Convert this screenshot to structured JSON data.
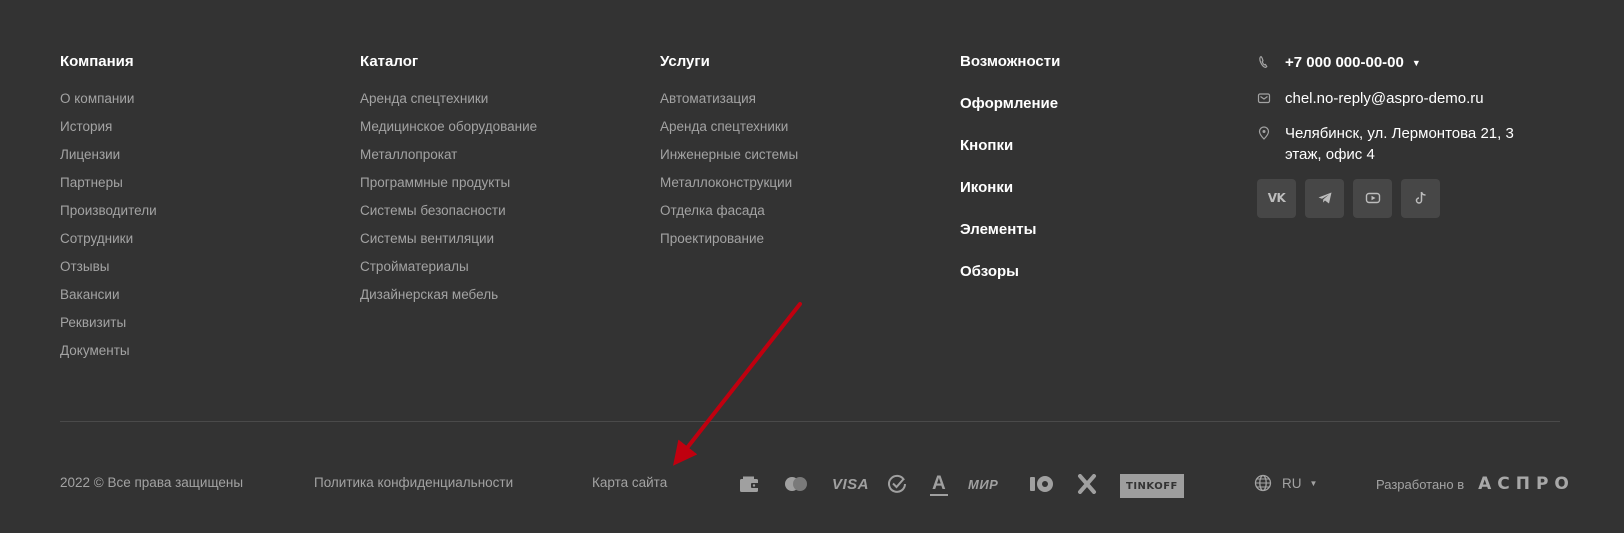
{
  "columns": {
    "company": {
      "title": "Компания",
      "items": [
        "О компании",
        "История",
        "Лицензии",
        "Партнеры",
        "Производители",
        "Сотрудники",
        "Отзывы",
        "Вакансии",
        "Реквизиты",
        "Документы"
      ]
    },
    "catalog": {
      "title": "Каталог",
      "items": [
        "Аренда спецтехники",
        "Медицинское оборудование",
        "Металлопрокат",
        "Программные продукты",
        "Системы безопасности",
        "Системы вентиляции",
        "Стройматериалы",
        "Дизайнерская мебель"
      ]
    },
    "services": {
      "title": "Услуги",
      "items": [
        "Автоматизация",
        "Аренда спецтехники",
        "Инженерные системы",
        "Металлоконструкции",
        "Отделка фасада",
        "Проектирование"
      ]
    },
    "features": {
      "title": "Возможности",
      "items": [
        "Оформление",
        "Кнопки",
        "Иконки",
        "Элементы",
        "Обзоры"
      ]
    }
  },
  "contacts": {
    "phone": "+7 000 000-00-00",
    "email": "chel.no-reply@aspro-demo.ru",
    "address_line1": "Челябинск, ул. Лермонтова 21, 3",
    "address_line2": "этаж, офис 4"
  },
  "socials": [
    "vk-icon",
    "telegram-icon",
    "youtube-icon",
    "tiktok-icon"
  ],
  "bottom": {
    "copyright": "2022 © Все права защищены",
    "privacy": "Политика конфиденциальности",
    "sitemap": "Карта сайта",
    "payments": {
      "visa": "VISA",
      "mir": "МИР",
      "tinkoff": "TINKOFF",
      "alfa": "A"
    },
    "lang": "RU",
    "developed_by": "Разработано в",
    "dev_logo": "АСПРО"
  },
  "colors": {
    "background": "#333333",
    "heading": "#ffffff",
    "link": "#a3a3a3",
    "social_bg": "#474747",
    "annotation_arrow": "#c0000f"
  }
}
